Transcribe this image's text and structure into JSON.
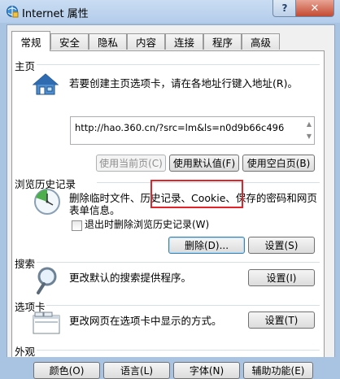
{
  "window": {
    "title": "Internet 属性",
    "help_label": "?",
    "close_label": "✕"
  },
  "tabs": [
    {
      "label": "常规",
      "active": true
    },
    {
      "label": "安全"
    },
    {
      "label": "隐私"
    },
    {
      "label": "内容"
    },
    {
      "label": "连接"
    },
    {
      "label": "程序"
    },
    {
      "label": "高级"
    }
  ],
  "homepage": {
    "title": "主页",
    "description": "若要创建主页选项卡，请在各地址行键入地址(R)。",
    "url_value": "http://hao.360.cn/?src=lm&ls=n0d9b66c496",
    "use_current_label": "使用当前页(C)",
    "use_default_label": "使用默认值(F)",
    "use_blank_label": "使用空白页(B)"
  },
  "history": {
    "title": "浏览历史记录",
    "description_line1": "删除临时文件、历史记录、Cookie、保存的密码和网页",
    "description_line2": "表单信息。",
    "delete_on_exit_label": "退出时删除浏览历史记录(W)",
    "delete_label": "删除(D)...",
    "settings_label": "设置(S)"
  },
  "search": {
    "title": "搜索",
    "description": "更改默认的搜索提供程序。",
    "settings_label": "设置(I)"
  },
  "tabs_group": {
    "title": "选项卡",
    "description": "更改网页在选项卡中显示的方式。",
    "settings_label": "设置(T)"
  },
  "appearance": {
    "title": "外观",
    "colors_label": "颜色(O)",
    "languages_label": "语言(L)",
    "fonts_label": "字体(N)",
    "accessibility_label": "辅助功能(E)"
  },
  "colors": {
    "highlight": "#e0242a",
    "title_bar": "#b4cdeb",
    "close_button": "#c34a32"
  }
}
